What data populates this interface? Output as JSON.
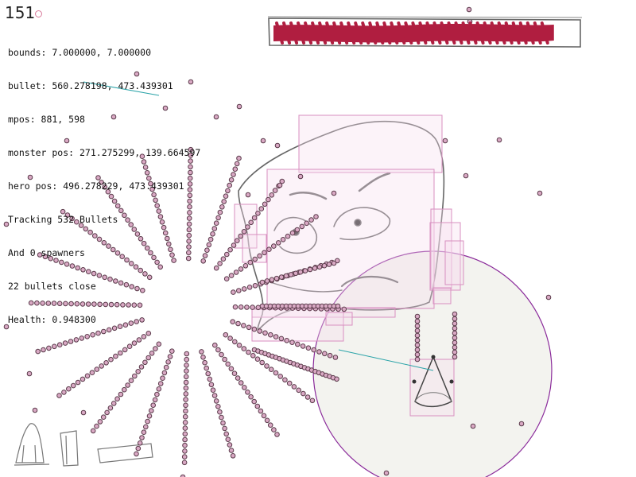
{
  "hud": {
    "frame_counter": "151"
  },
  "debug_lines": {
    "bounds": "bounds: 7.000000, 7.000000",
    "bullet": "bullet: 560.278198, 473.439301",
    "mpos": "mpos: 881, 598",
    "monster_pos": "monster pos: 271.275299, 139.664597",
    "hero_pos": "hero pos: 496.278229, 473.439301",
    "tracking": "Tracking 532 Bullets",
    "spawners": "And 0 spawners",
    "close": "22 bullets close",
    "health": "Health: 0.948300"
  },
  "boss_health": {
    "fraction": 0.9483,
    "fill_color": "#b01e40",
    "frame_color": "#666666"
  },
  "colors": {
    "bullet_fill": "#d9a9c4",
    "bullet_ring": "#5a3a4a",
    "hitbox": "#d88fc0",
    "hitbox_fill": "#f7e6f2",
    "hero_aura": "#f2f2ef",
    "hero_aura_stroke": "#8a2a9a",
    "tracer": "#2aa3a8",
    "sketch": "#555555"
  },
  "icons": {
    "monster": "sketched-monster-face",
    "hero": "sketched-triangle-hero",
    "scenery": "sketched-tombstone-and-blocks"
  }
}
